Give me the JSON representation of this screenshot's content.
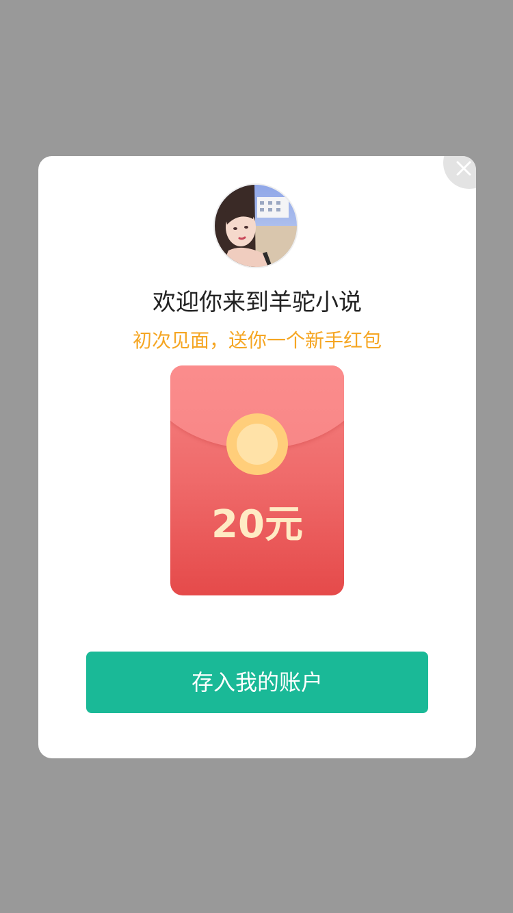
{
  "dialog": {
    "title": "欢迎你来到羊驼小说",
    "subtitle": "初次见面，送你一个新手红包",
    "close_icon": "close-icon",
    "avatar_icon": "user-avatar-photo"
  },
  "red_packet": {
    "amount": "20元",
    "coin_icon": "gold-coin-icon"
  },
  "actions": {
    "deposit_label": "存入我的账户"
  },
  "colors": {
    "backdrop": "#999999",
    "accent": "#1ab997",
    "subtitle": "#f5a623",
    "packet": "#ef6a6a"
  }
}
